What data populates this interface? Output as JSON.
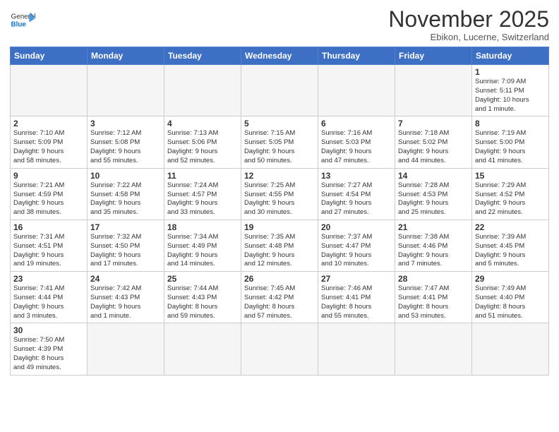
{
  "header": {
    "logo_general": "General",
    "logo_blue": "Blue",
    "month_title": "November 2025",
    "subtitle": "Ebikon, Lucerne, Switzerland"
  },
  "weekdays": [
    "Sunday",
    "Monday",
    "Tuesday",
    "Wednesday",
    "Thursday",
    "Friday",
    "Saturday"
  ],
  "weeks": [
    [
      {
        "day": "",
        "info": ""
      },
      {
        "day": "",
        "info": ""
      },
      {
        "day": "",
        "info": ""
      },
      {
        "day": "",
        "info": ""
      },
      {
        "day": "",
        "info": ""
      },
      {
        "day": "",
        "info": ""
      },
      {
        "day": "1",
        "info": "Sunrise: 7:09 AM\nSunset: 5:11 PM\nDaylight: 10 hours\nand 1 minute."
      }
    ],
    [
      {
        "day": "2",
        "info": "Sunrise: 7:10 AM\nSunset: 5:09 PM\nDaylight: 9 hours\nand 58 minutes."
      },
      {
        "day": "3",
        "info": "Sunrise: 7:12 AM\nSunset: 5:08 PM\nDaylight: 9 hours\nand 55 minutes."
      },
      {
        "day": "4",
        "info": "Sunrise: 7:13 AM\nSunset: 5:06 PM\nDaylight: 9 hours\nand 52 minutes."
      },
      {
        "day": "5",
        "info": "Sunrise: 7:15 AM\nSunset: 5:05 PM\nDaylight: 9 hours\nand 50 minutes."
      },
      {
        "day": "6",
        "info": "Sunrise: 7:16 AM\nSunset: 5:03 PM\nDaylight: 9 hours\nand 47 minutes."
      },
      {
        "day": "7",
        "info": "Sunrise: 7:18 AM\nSunset: 5:02 PM\nDaylight: 9 hours\nand 44 minutes."
      },
      {
        "day": "8",
        "info": "Sunrise: 7:19 AM\nSunset: 5:00 PM\nDaylight: 9 hours\nand 41 minutes."
      }
    ],
    [
      {
        "day": "9",
        "info": "Sunrise: 7:21 AM\nSunset: 4:59 PM\nDaylight: 9 hours\nand 38 minutes."
      },
      {
        "day": "10",
        "info": "Sunrise: 7:22 AM\nSunset: 4:58 PM\nDaylight: 9 hours\nand 35 minutes."
      },
      {
        "day": "11",
        "info": "Sunrise: 7:24 AM\nSunset: 4:57 PM\nDaylight: 9 hours\nand 33 minutes."
      },
      {
        "day": "12",
        "info": "Sunrise: 7:25 AM\nSunset: 4:55 PM\nDaylight: 9 hours\nand 30 minutes."
      },
      {
        "day": "13",
        "info": "Sunrise: 7:27 AM\nSunset: 4:54 PM\nDaylight: 9 hours\nand 27 minutes."
      },
      {
        "day": "14",
        "info": "Sunrise: 7:28 AM\nSunset: 4:53 PM\nDaylight: 9 hours\nand 25 minutes."
      },
      {
        "day": "15",
        "info": "Sunrise: 7:29 AM\nSunset: 4:52 PM\nDaylight: 9 hours\nand 22 minutes."
      }
    ],
    [
      {
        "day": "16",
        "info": "Sunrise: 7:31 AM\nSunset: 4:51 PM\nDaylight: 9 hours\nand 19 minutes."
      },
      {
        "day": "17",
        "info": "Sunrise: 7:32 AM\nSunset: 4:50 PM\nDaylight: 9 hours\nand 17 minutes."
      },
      {
        "day": "18",
        "info": "Sunrise: 7:34 AM\nSunset: 4:49 PM\nDaylight: 9 hours\nand 14 minutes."
      },
      {
        "day": "19",
        "info": "Sunrise: 7:35 AM\nSunset: 4:48 PM\nDaylight: 9 hours\nand 12 minutes."
      },
      {
        "day": "20",
        "info": "Sunrise: 7:37 AM\nSunset: 4:47 PM\nDaylight: 9 hours\nand 10 minutes."
      },
      {
        "day": "21",
        "info": "Sunrise: 7:38 AM\nSunset: 4:46 PM\nDaylight: 9 hours\nand 7 minutes."
      },
      {
        "day": "22",
        "info": "Sunrise: 7:39 AM\nSunset: 4:45 PM\nDaylight: 9 hours\nand 5 minutes."
      }
    ],
    [
      {
        "day": "23",
        "info": "Sunrise: 7:41 AM\nSunset: 4:44 PM\nDaylight: 9 hours\nand 3 minutes."
      },
      {
        "day": "24",
        "info": "Sunrise: 7:42 AM\nSunset: 4:43 PM\nDaylight: 9 hours\nand 1 minute."
      },
      {
        "day": "25",
        "info": "Sunrise: 7:44 AM\nSunset: 4:43 PM\nDaylight: 8 hours\nand 59 minutes."
      },
      {
        "day": "26",
        "info": "Sunrise: 7:45 AM\nSunset: 4:42 PM\nDaylight: 8 hours\nand 57 minutes."
      },
      {
        "day": "27",
        "info": "Sunrise: 7:46 AM\nSunset: 4:41 PM\nDaylight: 8 hours\nand 55 minutes."
      },
      {
        "day": "28",
        "info": "Sunrise: 7:47 AM\nSunset: 4:41 PM\nDaylight: 8 hours\nand 53 minutes."
      },
      {
        "day": "29",
        "info": "Sunrise: 7:49 AM\nSunset: 4:40 PM\nDaylight: 8 hours\nand 51 minutes."
      }
    ],
    [
      {
        "day": "30",
        "info": "Sunrise: 7:50 AM\nSunset: 4:39 PM\nDaylight: 8 hours\nand 49 minutes."
      },
      {
        "day": "",
        "info": ""
      },
      {
        "day": "",
        "info": ""
      },
      {
        "day": "",
        "info": ""
      },
      {
        "day": "",
        "info": ""
      },
      {
        "day": "",
        "info": ""
      },
      {
        "day": "",
        "info": ""
      }
    ]
  ]
}
